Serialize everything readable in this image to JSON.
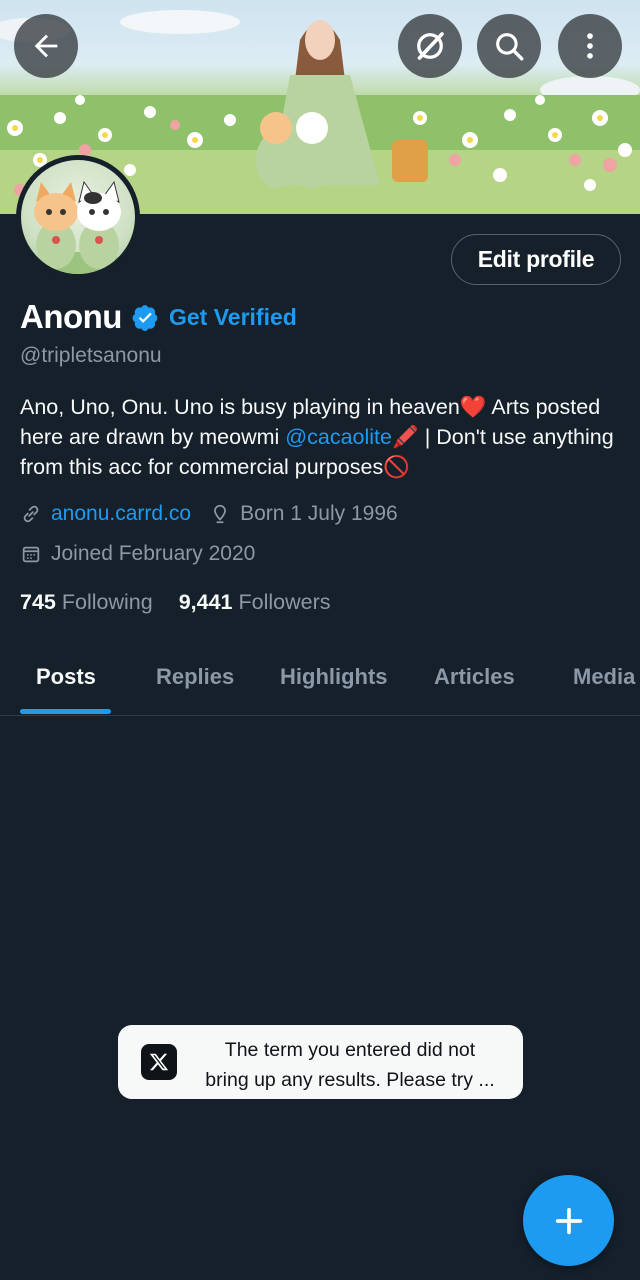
{
  "header": {
    "back_icon": "arrow-left-icon",
    "grok_icon": "grok-icon",
    "search_icon": "search-icon",
    "more_icon": "more-vertical-icon"
  },
  "profile": {
    "name": "Anonu",
    "verified_icon": "verified-badge-icon",
    "get_verified_label": "Get Verified",
    "handle": "@tripletsanonu",
    "edit_profile_label": "Edit profile",
    "bio_part1": "Ano, Uno, Onu. Uno is busy playing in heaven",
    "bio_emoji1": "❤️",
    "bio_part2": " Arts posted here are drawn by meowmi ",
    "bio_mention": "@cacaolite",
    "bio_emoji2": "🖍️",
    "bio_part3": " | Don't use anything from this acc for commercial purposes",
    "bio_emoji3": "🚫",
    "website": "anonu.carrd.co",
    "birthday": "Born 1 July 1996",
    "joined": "Joined February 2020",
    "following_count": "745",
    "following_label": "Following",
    "followers_count": "9,441",
    "followers_label": "Followers"
  },
  "tabs": [
    {
      "label": "Posts",
      "active": true
    },
    {
      "label": "Replies",
      "active": false
    },
    {
      "label": "Highlights",
      "active": false
    },
    {
      "label": "Articles",
      "active": false
    },
    {
      "label": "Media",
      "active": false
    }
  ],
  "toast": {
    "logo_icon": "x-logo-icon",
    "message_line1": "The term you entered did not",
    "message_line2": "bring up any results. Please try ..."
  },
  "fab": {
    "icon": "plus-icon"
  },
  "colors": {
    "background": "#15202b",
    "accent": "#1d9bf0",
    "secondary_text": "#8b98a5",
    "toast_bg": "#f7f9f9"
  }
}
